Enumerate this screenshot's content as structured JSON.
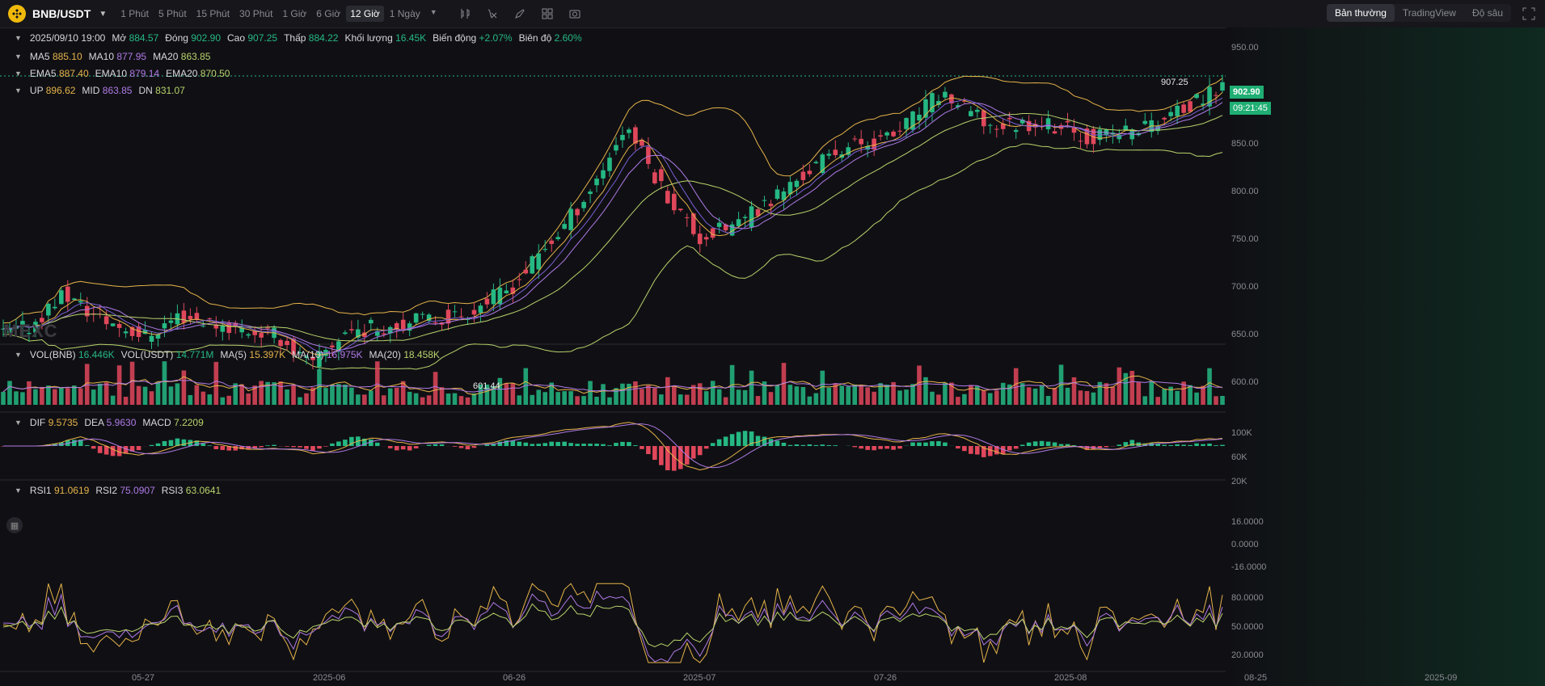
{
  "toolbar": {
    "pair": "BNB/USDT",
    "intervals": [
      "1 Phút",
      "5 Phút",
      "15 Phút",
      "30 Phút",
      "1 Giờ",
      "6 Giờ",
      "12 Giờ",
      "1 Ngày"
    ],
    "active_interval": "12 Giờ",
    "views": [
      "Bản thường",
      "TradingView",
      "Độ sâu"
    ],
    "active_view": "Bản thường",
    "tool_icons": [
      "indicator-icon",
      "formula-icon",
      "draw-icon",
      "layout-icon",
      "camera-icon"
    ]
  },
  "ohlc": {
    "date": "2025/09/10 19:00",
    "open_label": "Mở",
    "open": "884.57",
    "close_label": "Đóng",
    "close": "902.90",
    "high_label": "Cao",
    "high": "907.25",
    "low_label": "Thấp",
    "low": "884.22",
    "vol_label": "Khối lượng",
    "vol": "16.45K",
    "change_label": "Biến động",
    "change": "+2.07%",
    "amp_label": "Biên độ",
    "amp": "2.60%"
  },
  "ma": {
    "ma5_label": "MA5",
    "ma5": "885.10",
    "ma10_label": "MA10",
    "ma10": "877.95",
    "ma20_label": "MA20",
    "ma20": "863.85"
  },
  "ema": {
    "ema5_label": "EMA5",
    "ema5": "887.40",
    "ema10_label": "EMA10",
    "ema10": "879.14",
    "ema20_label": "EMA20",
    "ema20": "870.50"
  },
  "boll": {
    "up_label": "UP",
    "up": "896.62",
    "mid_label": "MID",
    "mid": "863.85",
    "dn_label": "DN",
    "dn": "831.07"
  },
  "volume": {
    "bnb_label": "VOL(BNB)",
    "bnb": "16.446K",
    "usdt_label": "VOL(USDT)",
    "usdt": "14.771M",
    "ma5_label": "MA(5)",
    "ma5": "15.397K",
    "ma10_label": "MA(10)",
    "ma10": "16.975K",
    "ma20_label": "MA(20)",
    "ma20": "18.458K"
  },
  "macd": {
    "dif_label": "DIF",
    "dif": "9.5735",
    "dea_label": "DEA",
    "dea": "5.9630",
    "macd_label": "MACD",
    "macd": "7.2209"
  },
  "rsi": {
    "rsi1_label": "RSI1",
    "rsi1": "91.0619",
    "rsi2_label": "RSI2",
    "rsi2": "75.0907",
    "rsi3_label": "RSI3",
    "rsi3": "63.0641"
  },
  "price_axis": [
    "950.00",
    "900.00",
    "850.00",
    "800.00",
    "750.00",
    "700.00",
    "650.00",
    "600.00"
  ],
  "current_price": "902.90",
  "countdown": "09:21:45",
  "high_marker": "907.25",
  "low_marker": "601.44",
  "vol_axis": [
    "100K",
    "60K",
    "20K"
  ],
  "macd_axis": [
    "16.0000",
    "0.0000",
    "-16.0000"
  ],
  "rsi_axis": [
    "80.0000",
    "50.0000",
    "20.0000"
  ],
  "dates": [
    "05-27",
    "2025-06",
    "06-26",
    "2025-07",
    "07-26",
    "2025-08",
    "08-25",
    "2025-09"
  ],
  "watermark": "MEXC",
  "colors": {
    "up": "#25b883",
    "down": "#e0475b",
    "ma5": "#e6b34a",
    "ma10": "#b07ae6",
    "ma20": "#b9d36b"
  }
}
